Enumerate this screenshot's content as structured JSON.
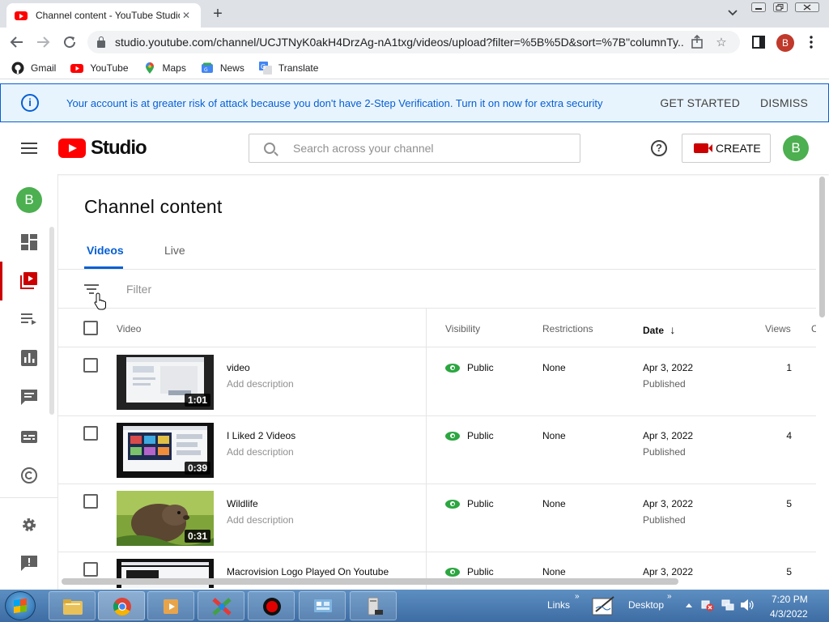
{
  "browser": {
    "tab_title": "Channel content - YouTube Studio",
    "tab_close": "✕",
    "new_tab": "+",
    "url": "studio.youtube.com/channel/UCJTNyK0akH4DrzAg-nA1txg/videos/upload?filter=%5B%5D&sort=%7B\"columnTy...",
    "profile_initial": "B"
  },
  "bookmarks": [
    {
      "label": "Gmail",
      "icon": "github-icon"
    },
    {
      "label": "YouTube",
      "icon": "youtube-icon"
    },
    {
      "label": "Maps",
      "icon": "maps-pin-icon"
    },
    {
      "label": "News",
      "icon": "news-icon"
    },
    {
      "label": "Translate",
      "icon": "translate-icon"
    }
  ],
  "banner": {
    "message": "Your account is at greater risk of attack because you don't have 2-Step Verification. Turn it on now for extra security",
    "get_started": "GET STARTED",
    "dismiss": "DISMISS",
    "color": "#065fd4"
  },
  "header": {
    "logo_word": "Studio",
    "search_placeholder": "Search across your channel",
    "help": "?",
    "create_label": "CREATE",
    "avatar_initial": "B"
  },
  "nav": {
    "avatar_initial": "B"
  },
  "page": {
    "title": "Channel content",
    "tabs": [
      "Videos",
      "Live"
    ],
    "filter_placeholder": "Filter"
  },
  "table": {
    "columns": {
      "video": "Video",
      "visibility": "Visibility",
      "restrictions": "Restrictions",
      "date": "Date",
      "views": "Views",
      "cut": "C"
    },
    "sort_arrow": "↓",
    "rows": [
      {
        "title": "video",
        "description": "Add description",
        "duration": "1:01",
        "visibility": "Public",
        "restrictions": "None",
        "date": "Apr 3, 2022",
        "status": "Published",
        "views": "1"
      },
      {
        "title": "I Liked 2 Videos",
        "description": "Add description",
        "duration": "0:39",
        "visibility": "Public",
        "restrictions": "None",
        "date": "Apr 3, 2022",
        "status": "Published",
        "views": "4"
      },
      {
        "title": "Wildlife",
        "description": "Add description",
        "duration": "0:31",
        "visibility": "Public",
        "restrictions": "None",
        "date": "Apr 3, 2022",
        "status": "Published",
        "views": "5"
      },
      {
        "title": "Macrovision Logo Played On Youtube",
        "description": "",
        "duration": "",
        "visibility": "Public",
        "restrictions": "None",
        "date": "Apr 3, 2022",
        "status": "",
        "views": "5"
      }
    ]
  },
  "taskbar": {
    "links": "Links",
    "desktop": "Desktop",
    "time": "7:20 PM",
    "date": "4/3/2022"
  },
  "colors": {
    "accent": "#065fd4",
    "brand_red": "#ff0000",
    "public_green": "#2ba640",
    "avatar_green": "#4caf50"
  }
}
